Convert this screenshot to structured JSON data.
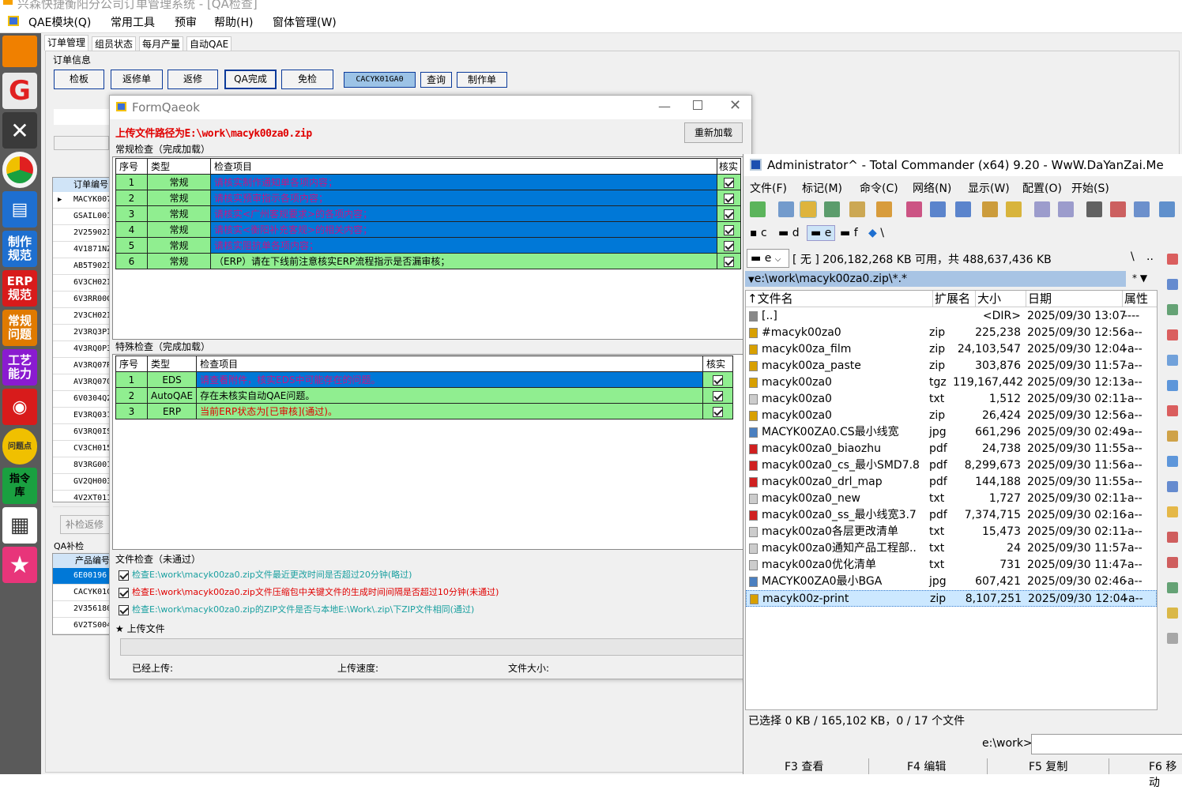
{
  "app": {
    "title": "兴森快捷衡阳分公司订单管理系统 - [QA检查]",
    "menu": [
      "QAE模块(Q)",
      "常用工具",
      "预审",
      "帮助(H)",
      "窗体管理(W)"
    ]
  },
  "leftbar": {
    "items": [
      "制作\n规范",
      "ERP\n规范",
      "常规\n问题",
      "工艺\n能力",
      "问题点",
      "指令\n库"
    ]
  },
  "tabs": [
    "订单管理",
    "组员状态",
    "每月产量",
    "自动QAE"
  ],
  "order_info": {
    "label": "订单信息",
    "buttons": [
      "检板",
      "返修单",
      "返修",
      "QA完成",
      "免检"
    ],
    "code": "CACYK01GA0",
    "query": "查询",
    "make": "制作单"
  },
  "left_grid": {
    "header": "订单编号",
    "rows": [
      "MACYK007",
      "GSAIL001",
      "2V25902I",
      "4V1871NZ",
      "AB5T902I",
      "6V3CH02I",
      "6V3RR00C",
      "2V3CH02I",
      "2V3RQ3PI",
      "4V3RQ0P3",
      "AV3RQ07R",
      "AV3RQ07Q",
      "6V0304Q2",
      "EV3RQ031",
      "6V3RQ0IS",
      "CV3CH015",
      "8V3RG001",
      "GV2QH003",
      "4V2XT011"
    ]
  },
  "bottom_left": {
    "button": "补检返修",
    "label": "QA补检",
    "header": "产品编号",
    "rows": [
      "6E00196",
      "CACYK01C",
      "2V356180",
      "6V2TS004"
    ]
  },
  "form": {
    "title": "FormQaeok",
    "path": "上传文件路径为E:\\work\\macyk00za0.zip",
    "reload": "重新加载",
    "regular": {
      "label": "常规检查（完成加载）",
      "headers": [
        "序号",
        "类型",
        "检查项目",
        "核实"
      ],
      "rows": [
        {
          "no": "1",
          "type": "常规",
          "item": "请核实制作通知单各项内容；"
        },
        {
          "no": "2",
          "type": "常规",
          "item": "请核实预审指示各项内容；"
        },
        {
          "no": "3",
          "type": "常规",
          "item": "请核实<广州客规要求>的各项内容；"
        },
        {
          "no": "4",
          "type": "常规",
          "item": "请核实<衡阳补充客规>的相关内容；"
        },
        {
          "no": "5",
          "type": "常规",
          "item": "请核实阻抗单各项内容；"
        },
        {
          "no": "6",
          "type": "常规",
          "item": "（ERP）请在下线前注意核实ERP流程指示是否漏审核；"
        }
      ]
    },
    "special": {
      "label": "特殊检查（完成加载）",
      "headers": [
        "序号",
        "类型",
        "检查项目",
        "核实"
      ],
      "rows": [
        {
          "no": "1",
          "type": "EDS",
          "item": "请查看附件，核实EDS中可能存在的问题。"
        },
        {
          "no": "2",
          "type": "AutoQAE",
          "item": "存在未核实自动QAE问题。"
        },
        {
          "no": "3",
          "type": "ERP",
          "item": "当前ERP状态为[已审核](通过)。"
        }
      ]
    },
    "file": {
      "label": "文件检查（未通过）",
      "items": [
        "检查E:\\work\\macyk00za0.zip文件最近更改时间是否超过20分钟(略过)",
        "检查E:\\work\\macyk00za0.zip文件压缩包中关键文件的生成时间间隔是否超过10分钟(未通过)",
        "检查E:\\work\\macyk00za0.zip的ZIP文件是否与本地E:\\Work\\.zip\\下ZIP文件相同(通过)"
      ]
    },
    "upload": {
      "label": "★ 上传文件",
      "uploaded": "已经上传:",
      "speed": "上传速度:",
      "size": "文件大小:"
    }
  },
  "tc": {
    "title": "Administrator^ - Total Commander (x64) 9.20 - WwW.DaYanZai.Me",
    "menu": [
      "文件(F)",
      "标记(M)",
      "命令(C)",
      "网络(N)",
      "显示(W)",
      "配置(O)",
      "开始(S)"
    ],
    "drives": [
      "c",
      "d",
      "e",
      "f",
      "\\"
    ],
    "drive_sel": "e",
    "free": "[ 无 ]  206,182,268 KB 可用，共 488,637,436 KB",
    "path": "e:\\work\\macyk00za0.zip\\*.*",
    "filter": "* ▼",
    "cols": [
      "↑文件名",
      "扩展名",
      "大小",
      "日期",
      "属性"
    ],
    "files": [
      {
        "n": "[..]",
        "e": "",
        "s": "<DIR>",
        "d": "2025/09/30 13:07",
        "a": "----"
      },
      {
        "n": "#macyk00za0",
        "e": "zip",
        "s": "225,238",
        "d": "2025/09/30 12:56",
        "a": "-a--"
      },
      {
        "n": "macyk00za_film",
        "e": "zip",
        "s": "24,103,547",
        "d": "2025/09/30 12:04",
        "a": "-a--"
      },
      {
        "n": "macyk00za_paste",
        "e": "zip",
        "s": "303,876",
        "d": "2025/09/30 11:57",
        "a": "-a--"
      },
      {
        "n": "macyk00za0",
        "e": "tgz",
        "s": "119,167,442",
        "d": "2025/09/30 12:13",
        "a": "-a--"
      },
      {
        "n": "macyk00za0",
        "e": "txt",
        "s": "1,512",
        "d": "2025/09/30 02:11",
        "a": "-a--"
      },
      {
        "n": "macyk00za0",
        "e": "zip",
        "s": "26,424",
        "d": "2025/09/30 12:56",
        "a": "-a--"
      },
      {
        "n": "MACYK00ZA0.CS最小线宽",
        "e": "jpg",
        "s": "661,296",
        "d": "2025/09/30 02:49",
        "a": "-a--"
      },
      {
        "n": "macyk00za0_biaozhu",
        "e": "pdf",
        "s": "24,738",
        "d": "2025/09/30 11:55",
        "a": "-a--"
      },
      {
        "n": "macyk00za0_cs_最小SMD7.8",
        "e": "pdf",
        "s": "8,299,673",
        "d": "2025/09/30 11:56",
        "a": "-a--"
      },
      {
        "n": "macyk00za0_drl_map",
        "e": "pdf",
        "s": "144,188",
        "d": "2025/09/30 11:55",
        "a": "-a--"
      },
      {
        "n": "macyk00za0_new",
        "e": "txt",
        "s": "1,727",
        "d": "2025/09/30 02:11",
        "a": "-a--"
      },
      {
        "n": "macyk00za0_ss_最小线宽3.7",
        "e": "pdf",
        "s": "7,374,715",
        "d": "2025/09/30 02:16",
        "a": "-a--"
      },
      {
        "n": "macyk00za0各层更改清单",
        "e": "txt",
        "s": "15,473",
        "d": "2025/09/30 02:11",
        "a": "-a--"
      },
      {
        "n": "macyk00za0通知产品工程部..",
        "e": "txt",
        "s": "24",
        "d": "2025/09/30 11:57",
        "a": "-a--"
      },
      {
        "n": "macyk00za0优化清单",
        "e": "txt",
        "s": "731",
        "d": "2025/09/30 11:47",
        "a": "-a--"
      },
      {
        "n": "MACYK00ZA0最小BGA",
        "e": "jpg",
        "s": "607,421",
        "d": "2025/09/30 02:46",
        "a": "-a--"
      },
      {
        "n": "macyk00z-print",
        "e": "zip",
        "s": "8,107,251",
        "d": "2025/09/30 12:04",
        "a": "-a--"
      }
    ],
    "status": "已选择 0 KB / 165,102 KB，0 / 17 个文件",
    "cmd_path": "e:\\work>",
    "fkeys": [
      "F3 查看",
      "F4 编辑",
      "F5 复制",
      "F6 移动"
    ]
  }
}
